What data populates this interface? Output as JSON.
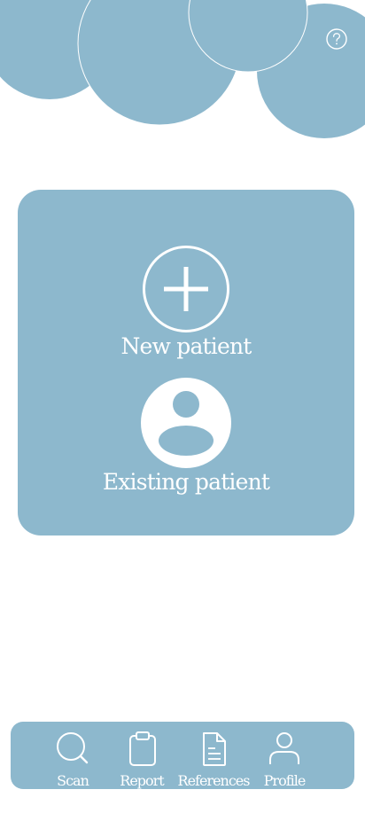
{
  "theme": {
    "accent": "#8db8cd",
    "text_on_accent": "#ffffff",
    "background": "#ffffff"
  },
  "header": {
    "help_icon": "question-circle-icon"
  },
  "card": {
    "actions": [
      {
        "label": "New patient",
        "icon": "plus-circle-icon"
      },
      {
        "label": "Existing patient",
        "icon": "user-avatar-icon"
      }
    ]
  },
  "nav": {
    "items": [
      {
        "label": "Scan",
        "icon": "search-icon"
      },
      {
        "label": "Report",
        "icon": "clipboard-icon"
      },
      {
        "label": "References",
        "icon": "document-icon"
      },
      {
        "label": "Profile",
        "icon": "user-icon"
      }
    ]
  }
}
